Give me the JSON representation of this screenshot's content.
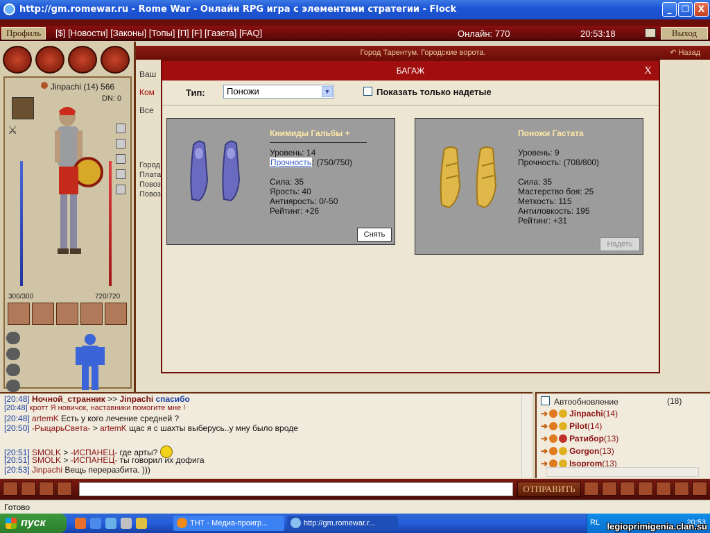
{
  "window": {
    "title": "http://gm.romewar.ru - Rome War - Онлайн RPG игра с элементами стратегии - Flock",
    "minimize_label": "_",
    "maximize_label": "❐",
    "close_label": "X"
  },
  "topbar": {
    "profile_label": "Профиль",
    "menu_text": "[$] [Новости] [Законы] [Топы] [П] [F] [Газета] [FAQ]",
    "online_text": "Онлайн: 770",
    "time": "20:53:18",
    "exit_label": "Выход"
  },
  "location": {
    "title": "Город Тарентум. Городские ворота.",
    "back_label": "Назад"
  },
  "player": {
    "name": "Jinpachi (14) 566",
    "dn": "DN: 0",
    "hp_left": "300/300",
    "hp_right": "720/720"
  },
  "background": {
    "frag1": "Ваш",
    "frag2": "Ком",
    "frag3": "Все",
    "frag4": "Город",
    "frag5": "Плата",
    "frag6": "Повоз",
    "frag7": "Повоз"
  },
  "bag": {
    "title": "БАГАЖ",
    "close": "X",
    "type_label": "Тип:",
    "type_value": "Поножи",
    "show_worn_label": "Показать только надетые",
    "items": [
      {
        "name": "Книмиды Гальбы +",
        "level": "Уровень: 14",
        "durability_label": "Прочность",
        "durability_value": ": (750/750)",
        "strength": "Сила: 35",
        "rage": "Ярость: 40",
        "antirage": "Антиярость: 0/-50",
        "rating": "Рейтинг: +26",
        "button": "Снять"
      },
      {
        "name": "Поножи Гастата",
        "level": "Уровень: 9",
        "durability": "Прочность: (708/800)",
        "strength": "Сила: 35",
        "mastery": "Мастерство боя: 25",
        "accuracy": "Меткость: 115",
        "antidodge": "Антиловкость: 195",
        "rating": "Рейтинг: +31",
        "button": "Надеть"
      }
    ]
  },
  "chat": {
    "lines": [
      {
        "time": "[20:48]",
        "from": "Ночной_странник",
        "sep": " >> ",
        "to": "Jinpachi",
        "text": " спасибо"
      },
      {
        "time": "[20:48]",
        "from": "кротт",
        "text": " Я новичок, наставники помогите мне !"
      },
      {
        "time": "[20:48]",
        "from": "artemK",
        "text": " Есть у кого лечение средней ?"
      },
      {
        "time": "[20:50]",
        "from": "-РыцарьСвета-",
        "sep": " > ",
        "to": "artemK",
        "text": " щас я с шахты выберусь..у мну было вроде"
      },
      {
        "time": "[20:51]",
        "from": "SMOLK",
        "sep": " > ",
        "to": "-ИСПАНЕЦ-",
        "text": " где арты?"
      },
      {
        "time": "[20:51]",
        "from": "SMOLK",
        "sep": " > ",
        "to": "-ИСПАНЕЦ-",
        "text": " ты говорил их дофига"
      },
      {
        "time": "[20:53]",
        "from": "Jinpachi",
        "text": " Вещь переразбита. )))"
      }
    ]
  },
  "users": {
    "autoupdate_label": "Автообновление",
    "count": "(18)",
    "list": [
      {
        "name": "Jinpachi",
        "level": "(14)"
      },
      {
        "name": "Pilot",
        "level": "(14)"
      },
      {
        "name": "Ратибор",
        "level": "(13)"
      },
      {
        "name": "Gorgon",
        "level": "(13)"
      },
      {
        "name": "Isoprom",
        "level": "(13)"
      }
    ]
  },
  "input": {
    "send_label": "ОТПРАВИТЬ"
  },
  "status": {
    "text": "Готово"
  },
  "taskbar": {
    "start_label": "пуск",
    "task1": "ТНТ - Медиа-проигр...",
    "task2": "http://gm.romewar.r...",
    "lang": "RL",
    "time": "20:53",
    "watermark": "legioprimigenia.clan.su"
  },
  "colors": {
    "accent_red": "#a10e0e",
    "title_blue": "#1d56d6",
    "item_name": "#ffe9a8"
  }
}
